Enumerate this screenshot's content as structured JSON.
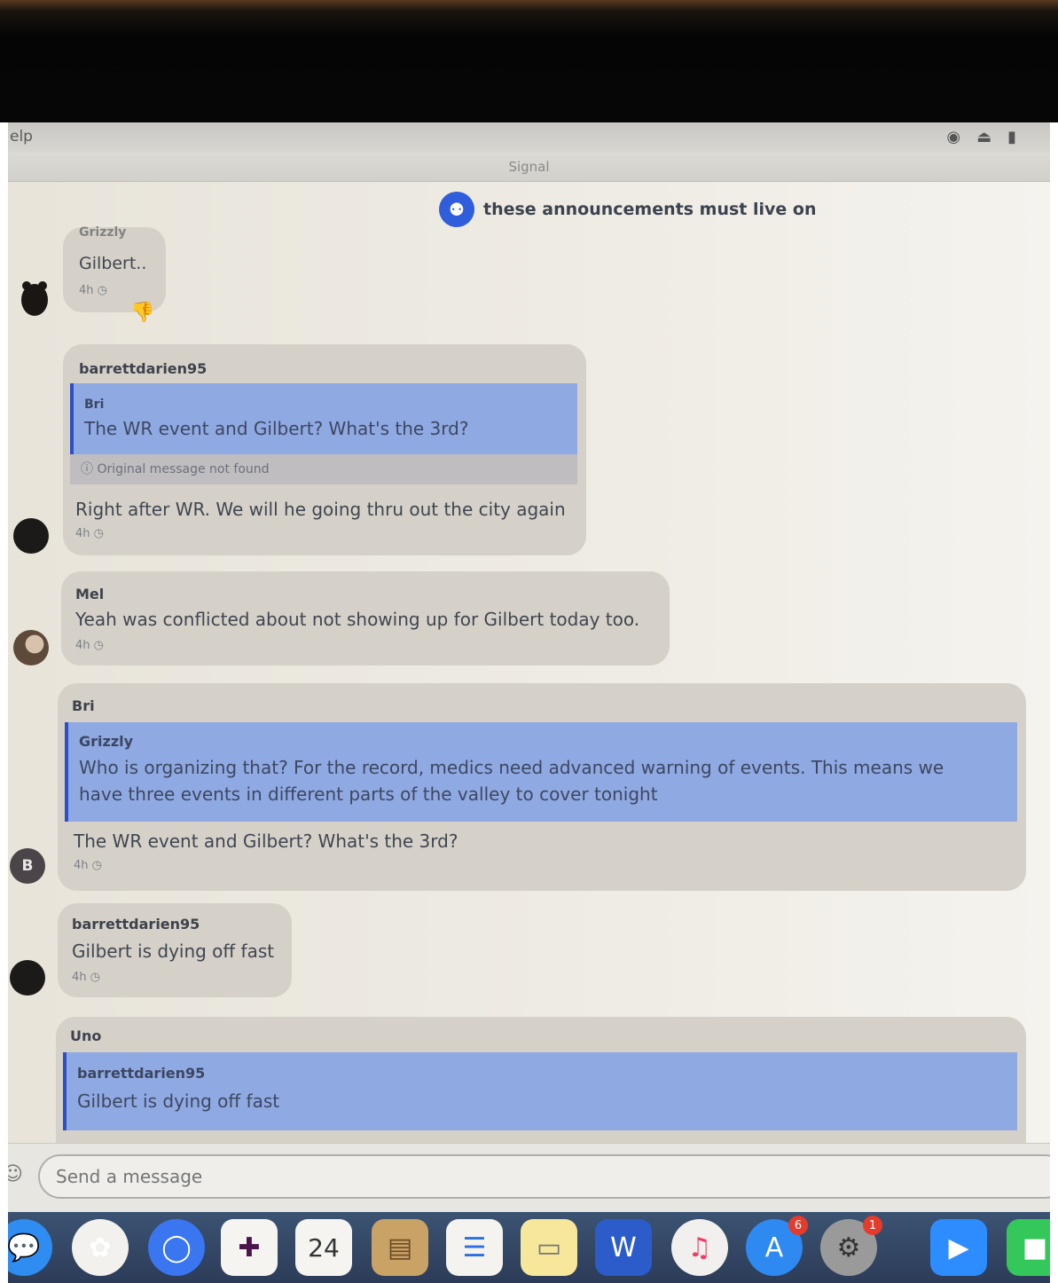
{
  "menubar": {
    "help_label": "elp"
  },
  "window": {
    "title": "Signal"
  },
  "conversation": {
    "title": "these announcements must live on"
  },
  "messages": [
    {
      "author": "Grizzly",
      "text": "Gilbert..",
      "time": "4h"
    },
    {
      "author": "barrettdarien95",
      "quote_author": "Bri",
      "quote_text": "The WR event and Gilbert? What's the 3rd?",
      "quote_notice": "Original message not found",
      "text": "Right after WR. We will he going thru out the city again",
      "time": "4h"
    },
    {
      "author": "Mel",
      "text": "Yeah was conflicted about not showing up for Gilbert today too.",
      "time": "4h"
    },
    {
      "author": "Bri",
      "avatar_letter": "B",
      "quote_author": "Grizzly",
      "quote_line1": "Who is organizing that? For the record, medics need advanced warning of events. This means we",
      "quote_line2": "have three events in different parts of the valley to cover tonight",
      "text": "The WR event and Gilbert? What's the 3rd?",
      "time": "4h"
    },
    {
      "author": "barrettdarien95",
      "text": "Gilbert is dying off fast",
      "time": "4h"
    },
    {
      "author": "Uno",
      "quote_author": "barrettdarien95",
      "quote_text": "Gilbert is dying off fast"
    }
  ],
  "composer": {
    "placeholder": "Send a message"
  },
  "dock": {
    "calendar_day": "24",
    "appstore_badge": "6",
    "settings_badge": "1"
  },
  "colors": {
    "accent_blue": "#2f5ddc",
    "quote_fill": "#8fa9e3",
    "bubble": "#d6d1c8"
  }
}
